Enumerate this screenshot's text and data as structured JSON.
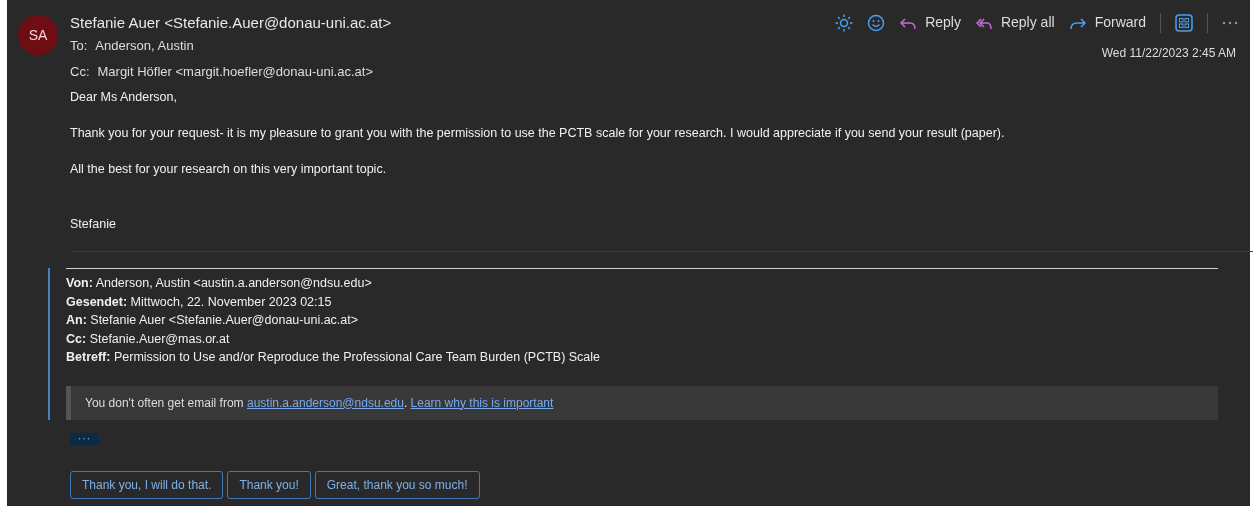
{
  "message": {
    "avatar_initials": "SA",
    "sender": "Stefanie Auer <Stefanie.Auer@donau-uni.ac.at>",
    "to_label": "To:",
    "to": "Anderson, Austin",
    "cc_label": "Cc:",
    "cc": "Margit Höfler <margit.hoefler@donau-uni.ac.at>",
    "date": "Wed 11/22/2023 2:45 AM"
  },
  "actions": [
    {
      "label": "Reply"
    },
    {
      "label": "Reply all"
    },
    {
      "label": "Forward"
    }
  ],
  "body": [
    "Dear Ms Anderson,",
    "Thank you for your request- it is my pleasure to grant you with the permission to use the PCTB scale for your research. I would appreciate if you send your result (paper).",
    "All the best for your research on this very important topic.",
    "Stefanie"
  ],
  "quoted": {
    "headers": [
      {
        "label": "Von:",
        "value": "Anderson, Austin <austin.a.anderson@ndsu.edu>"
      },
      {
        "label": "Gesendet:",
        "value": "Mittwoch, 22. November 2023 02:15"
      },
      {
        "label": "An:",
        "value": "Stefanie Auer <Stefanie.Auer@donau-uni.ac.at>"
      },
      {
        "label": "Cc:",
        "value": "Stefanie.Auer@mas.or.at"
      },
      {
        "label": "Betreff:",
        "value": "Permission to Use and/or Reproduce the Professional Care Team Burden (PCTB) Scale"
      }
    ],
    "notice": {
      "text": "You don't often get email from ",
      "link": "austin.a.anderson@ndsu.edu",
      "separator": ". ",
      "learn_link": "Learn why this is important"
    }
  },
  "expand_button": "···",
  "suggested_replies": [
    "Thank you, I will do that.",
    "Thank you!",
    "Great, thank you so much!"
  ]
}
